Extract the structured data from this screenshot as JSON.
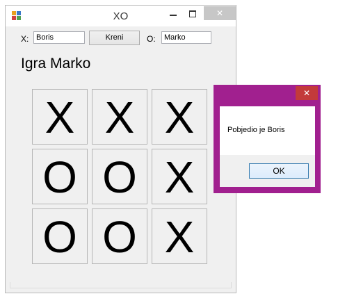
{
  "window": {
    "title": "XO",
    "close_glyph": "✕"
  },
  "form": {
    "x_label": "X:",
    "x_value": "Boris",
    "start_button": "Kreni",
    "o_label": "O:",
    "o_value": "Marko"
  },
  "status": "Igra Marko",
  "board": {
    "cells": [
      "X",
      "X",
      "X",
      "O",
      "O",
      "X",
      "O",
      "O",
      "X"
    ]
  },
  "dialog": {
    "message": "Pobjedio je Boris",
    "ok_label": "OK",
    "close_glyph": "✕",
    "accent_color": "#a1208f"
  },
  "icons": [
    "app-icon",
    "minimize-icon",
    "maximize-icon",
    "close-icon"
  ]
}
